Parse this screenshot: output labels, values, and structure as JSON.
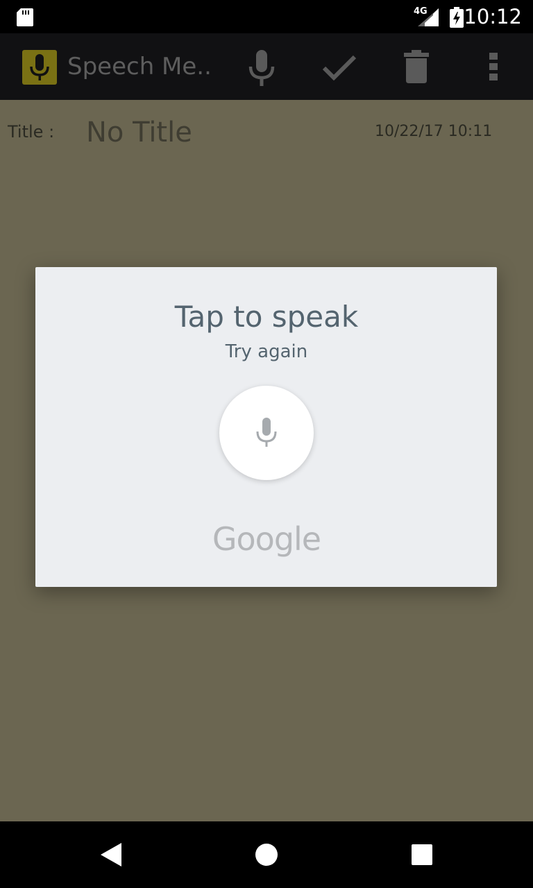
{
  "status_bar": {
    "network": "4G",
    "time": "10:12",
    "icons": [
      "sd-card-icon",
      "signal-icon",
      "battery-charging-icon"
    ]
  },
  "app_bar": {
    "title": "Speech Me...",
    "actions": [
      "microphone-icon",
      "check-icon",
      "trash-icon",
      "overflow-menu-icon"
    ]
  },
  "note": {
    "title_label": "Title :",
    "title_value": "No Title",
    "timestamp": "10/22/17 10:11"
  },
  "dialog": {
    "title": "Tap to speak",
    "subtitle": "Try again",
    "brand": "Google"
  },
  "nav_bar": {
    "buttons": [
      "back-icon",
      "home-icon",
      "recents-icon"
    ]
  },
  "colors": {
    "content_bg": "#6b6651",
    "dialog_bg": "#eceef1",
    "dialog_text": "#54646f",
    "logo_bg": "#7a7114"
  }
}
